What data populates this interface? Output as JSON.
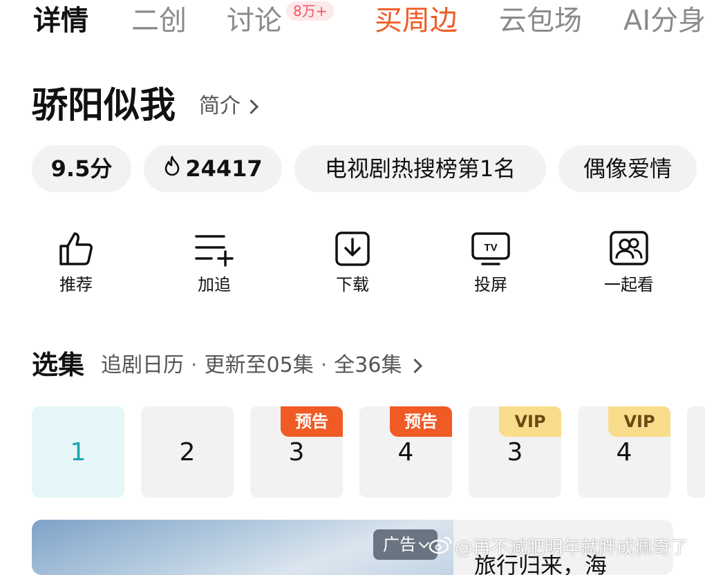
{
  "tabs": [
    {
      "label": "详情"
    },
    {
      "label": "二创"
    },
    {
      "label": "讨论",
      "badge": "8万+"
    },
    {
      "label": "买周边"
    },
    {
      "label": "云包场"
    },
    {
      "label": "AI分身"
    }
  ],
  "show": {
    "title": "骄阳似我",
    "intro_label": "简介"
  },
  "chips": {
    "score": "9.5分",
    "heat": "24417",
    "rank": "电视剧热搜榜第1名",
    "genre": "偶像爱情"
  },
  "actions": [
    {
      "label": "推荐",
      "icon": "thumbs-up-icon"
    },
    {
      "label": "加追",
      "icon": "add-to-list-icon"
    },
    {
      "label": "下载",
      "icon": "download-icon"
    },
    {
      "label": "投屏",
      "icon": "tv-cast-icon"
    },
    {
      "label": "一起看",
      "icon": "watch-together-icon"
    }
  ],
  "episodes_section": {
    "title": "选集",
    "calendar": "追剧日历",
    "update": "更新至05集",
    "total": "全36集"
  },
  "episodes": [
    {
      "number": "1",
      "tag": "",
      "selected": true
    },
    {
      "number": "2",
      "tag": ""
    },
    {
      "number": "3",
      "tag": "预告"
    },
    {
      "number": "4",
      "tag": "预告"
    },
    {
      "number": "3",
      "tag": "VIP"
    },
    {
      "number": "4",
      "tag": "VIP"
    }
  ],
  "ad": {
    "badge": "广告",
    "text": "旅行归来，海"
  },
  "watermark": "@再不减肥明年就胖成佩奇了",
  "colors": {
    "accent": "#f05a24",
    "selected_episode": "#1aa6b0",
    "vip": "#f9dc8c"
  }
}
